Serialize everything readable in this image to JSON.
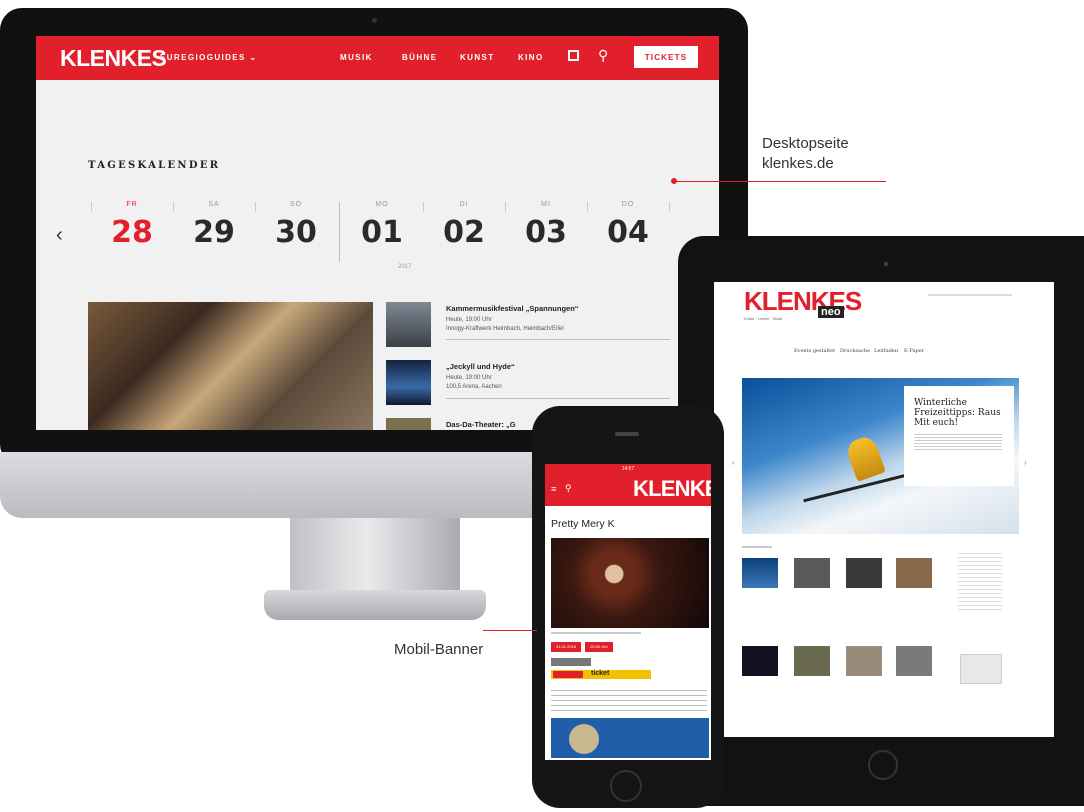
{
  "desktop": {
    "logo": "KLENKES",
    "nav": {
      "euregio": "EUREGIOGUIDES",
      "items": [
        "MUSIK",
        "BÜHNE",
        "KUNST",
        "KINO"
      ],
      "tickets": "TICKETS"
    },
    "calendar": {
      "heading": "TAGESKALENDER",
      "days": [
        {
          "label": "FR",
          "num": "28",
          "active": true
        },
        {
          "label": "SA",
          "num": "29"
        },
        {
          "label": "SO",
          "num": "30"
        },
        {
          "label": "MO",
          "num": "01"
        },
        {
          "label": "DI",
          "num": "02"
        },
        {
          "label": "MI",
          "num": "03"
        },
        {
          "label": "DO",
          "num": "04"
        }
      ],
      "year": "2017"
    },
    "events": [
      {
        "title": "Kammermusikfestival „Spannungen“",
        "sub1": "Heute, 19:00 Uhr",
        "sub2": "Innogy-Kraftwerk Heimbach, Heimbach/Eifel"
      },
      {
        "title": "„Jeckyll und Hyde“",
        "sub1": "Heute, 19:00 Uhr",
        "sub2": "100,5 Arena, Aachen"
      },
      {
        "title": "Das-Da-Theater: „G",
        "sub1": "",
        "sub2": ""
      }
    ]
  },
  "tablet": {
    "logo": "KLENKES",
    "logo_badge": "neo",
    "tagline": "Kultur · Leben · Stadt",
    "nav": [
      "Events gestaltet",
      "Drucksache",
      "Leitfaden",
      "E-Paper"
    ],
    "hero_title": "Winterliche Freizeittipps: Raus Mit euch!"
  },
  "phone": {
    "status": "14:57",
    "logo": "KLENKES",
    "title": "Pretty Mery K",
    "buttons": [
      "31.01.2018",
      "20:00 Uhr"
    ],
    "banner": "ticket"
  },
  "callouts": {
    "desktop": "Desktopseite klenkes.de",
    "mobile": "Mobil-Banner"
  }
}
